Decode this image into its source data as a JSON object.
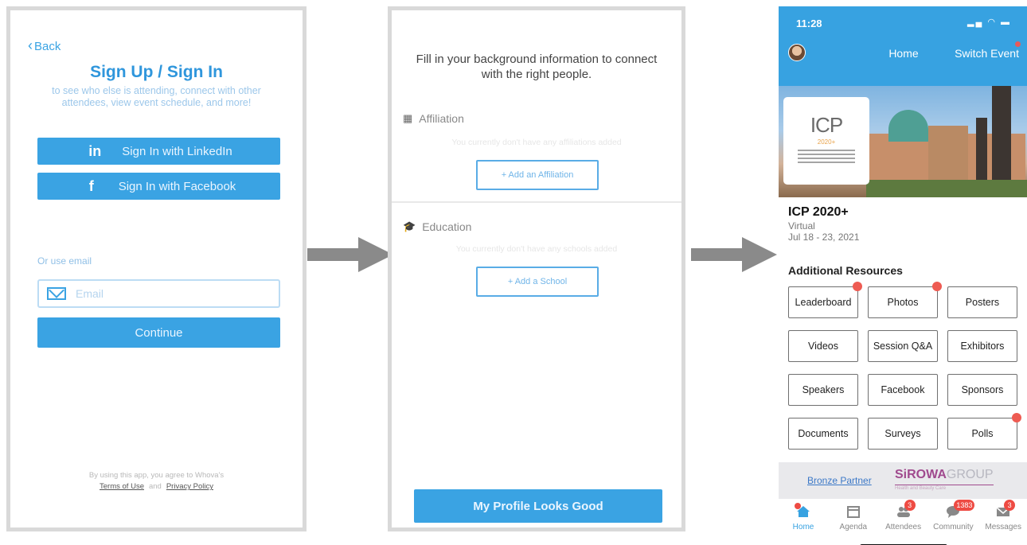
{
  "screen1": {
    "back_label": "Back",
    "title": "Sign Up / Sign In",
    "subtitle": "to see who else is attending, connect with other attendees, view event schedule, and more!",
    "linkedin_icon": "in",
    "linkedin_label": "Sign In with LinkedIn",
    "facebook_icon": "f",
    "facebook_label": "Sign In with Facebook",
    "or_email_label": "Or use email",
    "email_placeholder": "Email",
    "continue_label": "Continue",
    "legal_text": "By using this app, you agree to Whova's",
    "terms_label": "Terms of Use",
    "legal_and": "and",
    "privacy_label": "Privacy Policy"
  },
  "screen2": {
    "intro": "Fill in your background information to connect with the right people.",
    "affiliation_title": "Affiliation",
    "affiliation_empty": "You currently don't have any affiliations added",
    "add_affiliation_label": "+ Add an Affiliation",
    "education_title": "Education",
    "education_empty": "You currently don't have any schools added",
    "add_school_label": "+ Add a School",
    "profile_button_label": "My Profile Looks Good"
  },
  "screen3": {
    "status_time": "11:28",
    "header_title": "Home",
    "switch_event_label": "Switch Event",
    "logo_text": "ICP",
    "logo_year": "2020+",
    "event_title": "ICP 2020+",
    "event_location": "Virtual",
    "event_dates": "Jul 18 - 23, 2021",
    "resources_title": "Additional Resources",
    "tiles": [
      {
        "label": "Leaderboard",
        "dot": true
      },
      {
        "label": "Photos",
        "dot": true
      },
      {
        "label": "Posters",
        "dot": false
      },
      {
        "label": "Videos",
        "dot": false
      },
      {
        "label": "Session Q&A",
        "dot": false
      },
      {
        "label": "Exhibitors",
        "dot": false
      },
      {
        "label": "Speakers",
        "dot": false
      },
      {
        "label": "Facebook",
        "dot": false
      },
      {
        "label": "Sponsors",
        "dot": false
      },
      {
        "label": "Documents",
        "dot": false
      },
      {
        "label": "Surveys",
        "dot": false
      },
      {
        "label": "Polls",
        "dot": true
      }
    ],
    "partner_label": "Bronze Partner",
    "sponsor_name_bold": "SiROWA",
    "sponsor_name_light": "GROUP",
    "sponsor_tagline": "Health and Beauty Care",
    "tabs": [
      {
        "label": "Home",
        "icon": "home-icon",
        "badge": "",
        "active": true
      },
      {
        "label": "Agenda",
        "icon": "calendar-icon",
        "badge": "",
        "active": false
      },
      {
        "label": "Attendees",
        "icon": "people-icon",
        "badge": "3",
        "active": false
      },
      {
        "label": "Community",
        "icon": "chat-icon",
        "badge": "1383",
        "active": false
      },
      {
        "label": "Messages",
        "icon": "mail-icon",
        "badge": "3",
        "active": false
      }
    ]
  },
  "colors": {
    "brand_blue": "#37a2e1",
    "badge_red": "#ee4b43",
    "arrow_gray": "#8a8a8a"
  }
}
